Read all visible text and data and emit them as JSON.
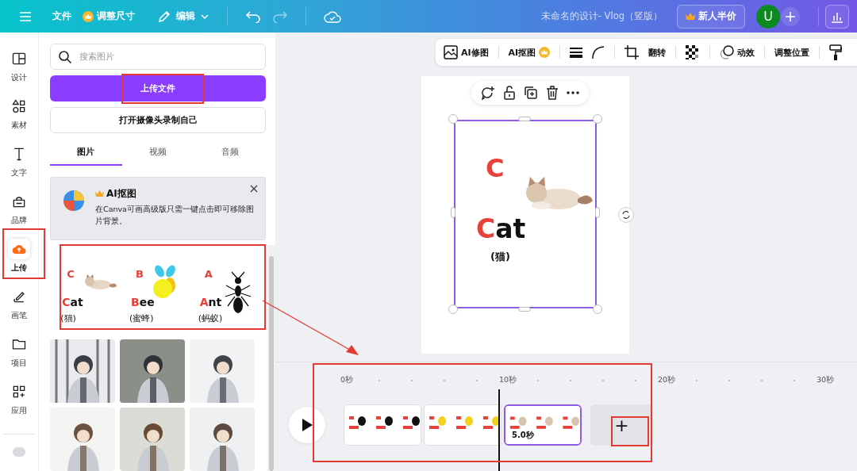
{
  "topbar": {
    "file_menu": "文件",
    "resize": "调整尺寸",
    "edit": "编辑",
    "title": "未命名的设计- Vlog（竖版）",
    "promo": "新人半价",
    "avatar": "U"
  },
  "rail": [
    {
      "label": "设计",
      "selected": false
    },
    {
      "label": "素材",
      "selected": false
    },
    {
      "label": "文字",
      "selected": false
    },
    {
      "label": "品牌",
      "selected": false
    },
    {
      "label": "上传",
      "selected": true
    },
    {
      "label": "画笔",
      "selected": false
    },
    {
      "label": "项目",
      "selected": false
    },
    {
      "label": "应用",
      "selected": false
    }
  ],
  "panel": {
    "search": {
      "placeholder": "搜索图片"
    },
    "upload_button": "上传文件",
    "camera_button": "打开摄像头录制自己",
    "tabs": [
      {
        "label": "图片",
        "selected": true
      },
      {
        "label": "视频",
        "selected": false
      },
      {
        "label": "音频",
        "selected": false
      }
    ],
    "promo_card": {
      "title": "AI抠图",
      "text": "在Canva可画高级版只需一键点击即可移除图片背景。"
    },
    "upload_card": [
      {
        "letter": "C",
        "initial": "C",
        "rest": "at",
        "translation": "(猫)"
      },
      {
        "letter": "B",
        "initial": "B",
        "rest": "ee",
        "translation": "(蜜蜂)"
      },
      {
        "letter": "A",
        "initial": "A",
        "rest": "nt",
        "translation": "(蚂蚁)"
      }
    ]
  },
  "toolbar": {
    "retouch": "AI修图",
    "cutout": "AI抠图",
    "flip": "翻转",
    "animate": "动效",
    "position": "调整位置"
  },
  "page": {
    "letter": "C",
    "initial": "C",
    "rest": "at",
    "translation": "(猫)"
  },
  "timeline": {
    "ticks": [
      "0秒",
      "10秒",
      "20秒",
      "30秒"
    ],
    "clips": [
      {
        "selected": false
      },
      {
        "selected": false
      },
      {
        "selected": true,
        "duration": "5.0秒"
      }
    ],
    "add_button": "+"
  }
}
